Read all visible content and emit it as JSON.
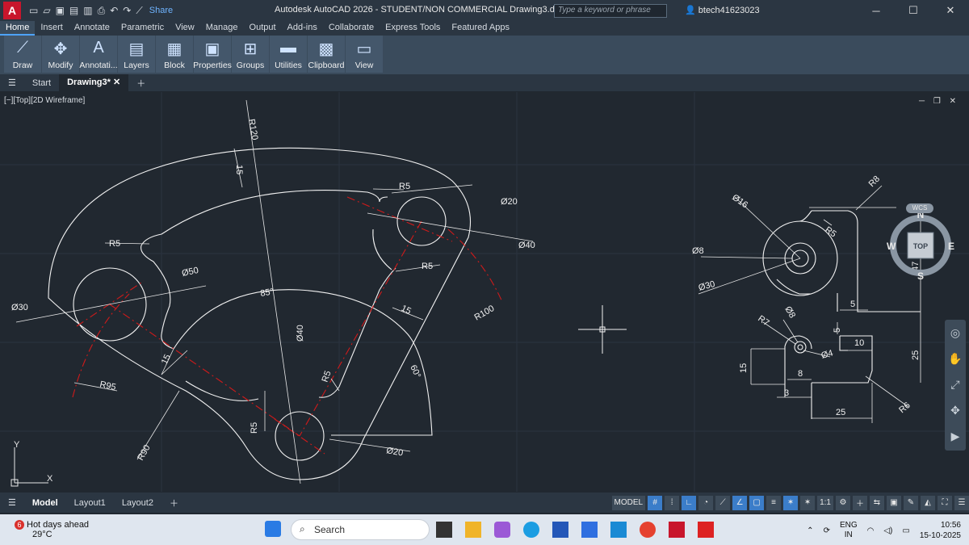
{
  "titlebar": {
    "app_letter": "A",
    "share": "Share",
    "title": "Autodesk AutoCAD 2026 - STUDENT/NON COMMERCIAL   Drawing3.dwg",
    "search_placeholder": "Type a keyword or phrase",
    "user": "btech41623023"
  },
  "ribbon_tabs": [
    "Home",
    "Insert",
    "Annotate",
    "Parametric",
    "View",
    "Manage",
    "Output",
    "Add-ins",
    "Collaborate",
    "Express Tools",
    "Featured Apps"
  ],
  "ribbon_panels": [
    "Draw",
    "Modify",
    "Annotati...",
    "Layers",
    "Block",
    "Properties",
    "Groups",
    "Utilities",
    "Clipboard",
    "View"
  ],
  "doc_tabs": {
    "start": "Start",
    "current": "Drawing3*"
  },
  "viewport": {
    "info": "[−][Top][2D Wireframe]",
    "compass": {
      "n": "N",
      "s": "S",
      "e": "E",
      "w": "W",
      "top": "TOP"
    },
    "wcs": "WCS",
    "ucs": {
      "x": "X",
      "y": "Y"
    }
  },
  "dims_left": {
    "r120": "R120",
    "d15a": "15",
    "r5a": "R5",
    "d20": "Ø20",
    "d40": "Ø40",
    "r5b": "R5",
    "d50": "Ø50",
    "d30": "Ø30",
    "a85": "85°",
    "r5c": "R5",
    "d15b": "15",
    "r100": "R100",
    "d15c": "15",
    "d40b": "Ø40",
    "a60": "60°",
    "r95": "R95",
    "r5d": "R5",
    "r5e": "R5",
    "r90": "R90",
    "d20b": "Ø20"
  },
  "dims_right": {
    "d16": "Ø16",
    "r8": "R8",
    "r5": "R5",
    "d8": "Ø8",
    "d30": "Ø30",
    "d47": "47",
    "d5a": "5",
    "d5b": "5",
    "r7": "R7",
    "d8b": "Ø8",
    "d10": "10",
    "d4": "Ø4",
    "d15": "15",
    "d8c": "8",
    "d25a": "25",
    "d3": "3",
    "d25b": "25",
    "r6": "R6"
  },
  "layout_tabs": [
    "Model",
    "Layout1",
    "Layout2"
  ],
  "status": {
    "model": "MODEL",
    "scale": "1:1"
  },
  "taskbar": {
    "weather_badge": "6",
    "weather_title": "Hot days ahead",
    "weather_temp": "29°C",
    "search": "Search",
    "lang1": "ENG",
    "lang2": "IN",
    "time": "10:56",
    "date": "15-10-2025"
  },
  "colors": {
    "accent": "#4da3ff",
    "centerline": "#d11a1a",
    "geometry": "#ffffff",
    "canvas": "#212830"
  }
}
